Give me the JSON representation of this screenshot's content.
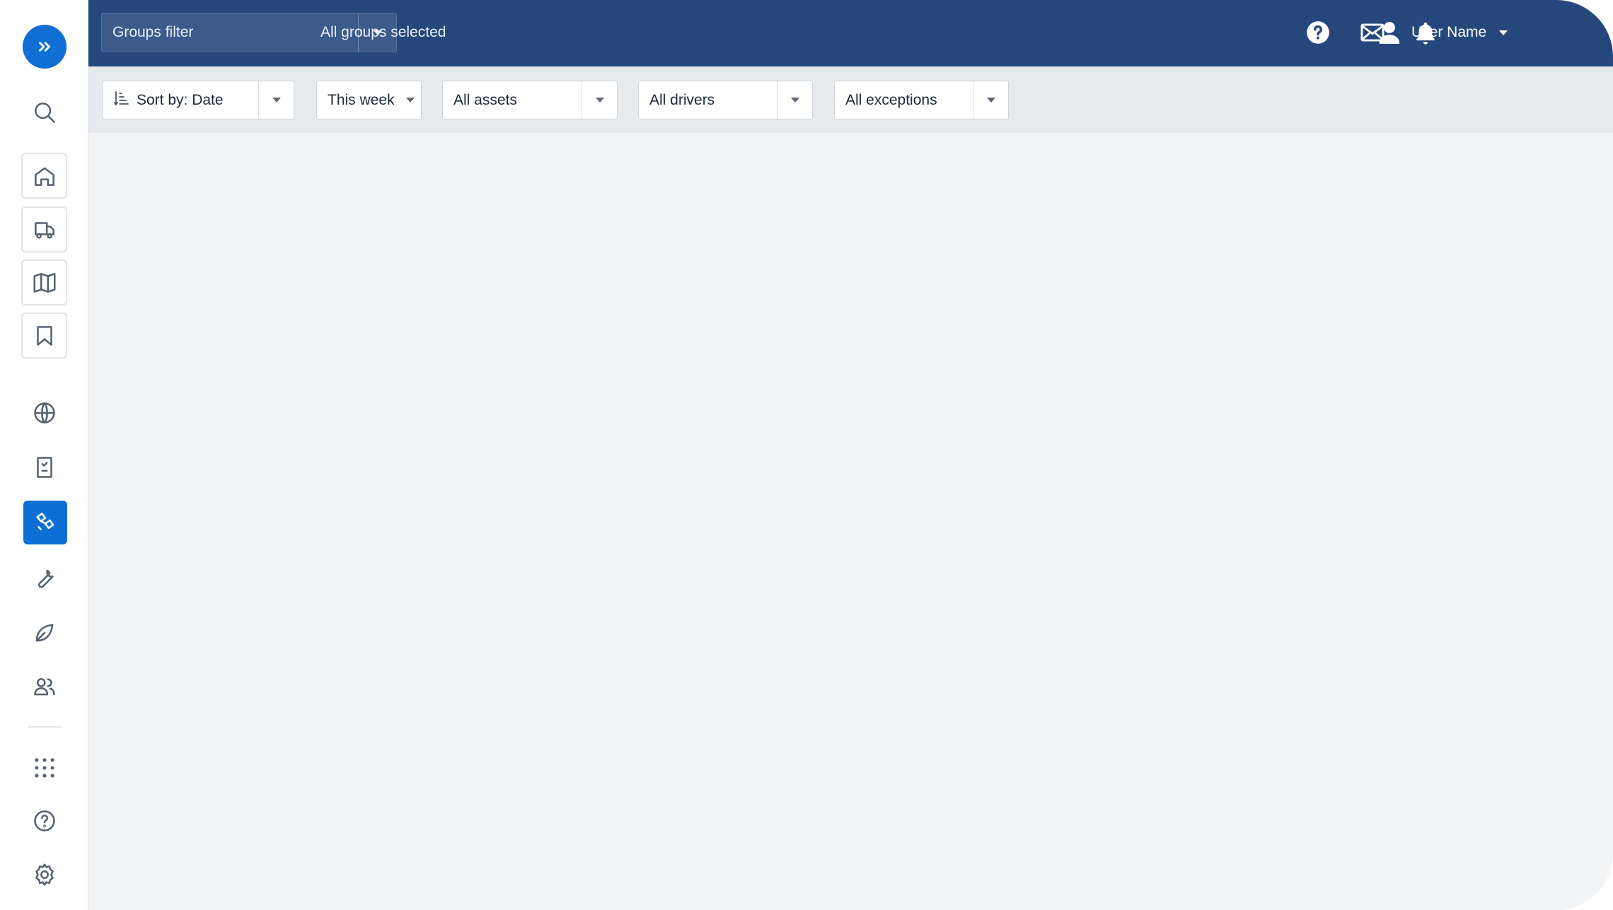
{
  "topbar": {
    "groups_filter_label": "Groups filter",
    "groups_selected_text": "All groups selected",
    "user_name": "User Name"
  },
  "filters": {
    "sort_label": "Sort by: Date",
    "period_label": "This week",
    "assets_label": "All assets",
    "drivers_label": "All drivers",
    "exceptions_label": "All exceptions"
  },
  "sidebar": {
    "items": [
      {
        "icon": "search-icon"
      },
      {
        "icon": "home-icon"
      },
      {
        "icon": "truck-icon"
      },
      {
        "icon": "map-icon"
      },
      {
        "icon": "bookmark-icon"
      },
      {
        "icon": "globe-icon"
      },
      {
        "icon": "report-icon"
      },
      {
        "icon": "rules-icon",
        "active": true
      },
      {
        "icon": "wrench-icon"
      },
      {
        "icon": "leaf-icon"
      },
      {
        "icon": "people-icon"
      },
      {
        "icon": "apps-grid-icon"
      },
      {
        "icon": "help-circle-icon"
      },
      {
        "icon": "settings-gear-icon"
      }
    ]
  },
  "colors": {
    "topbar_bg": "#25477b",
    "accent": "#0d6fd4",
    "content_bg": "#f2f4f6"
  }
}
